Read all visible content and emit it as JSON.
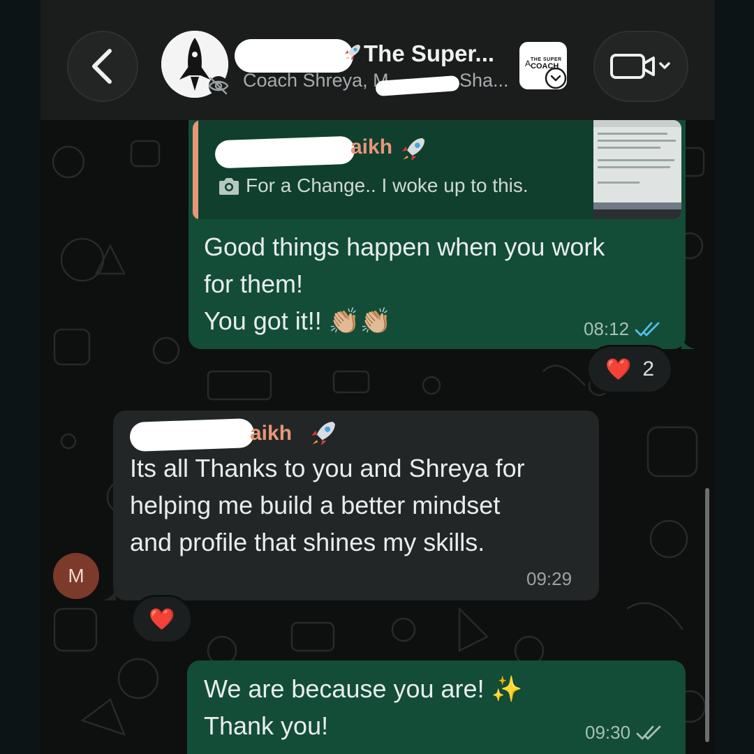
{
  "header": {
    "group_title": "The Super...",
    "subtitle_members": "Coach Shreya, M",
    "subtitle_members_tail": "Sha...",
    "badge_text_top": "THE SUPER",
    "badge_text_main": "COACH",
    "back_icon": "chevron-left-icon",
    "video_icon": "video-call-icon"
  },
  "messages": [
    {
      "direction": "outgoing",
      "quoted_sender_tail": "aikh",
      "quoted_text": "For a Change.. I woke up to this.",
      "lines": [
        "Good things happen when you work",
        "for them!",
        "You got it!! 👏🏼👏🏼"
      ],
      "time": "08:12",
      "status": "read",
      "reaction": {
        "emoji": "❤️",
        "count": "2"
      }
    },
    {
      "direction": "incoming",
      "sender_tail": "aikh",
      "sender_avatar_initial": "M",
      "lines": [
        "Its all Thanks to you and Shreya for",
        "helping me build a better mindset",
        "and profile that shines my skills."
      ],
      "time": "09:29",
      "reaction": {
        "emoji": "❤️"
      }
    },
    {
      "direction": "outgoing",
      "lines": [
        "We are because you are! ✨",
        "Thank you!"
      ],
      "time": "09:30",
      "status": "delivered"
    }
  ],
  "colors": {
    "outgoing_bubble": "#134d37",
    "incoming_bubble": "#232626",
    "read_ticks": "#53bdeb",
    "sender_name": "#e8967a"
  }
}
